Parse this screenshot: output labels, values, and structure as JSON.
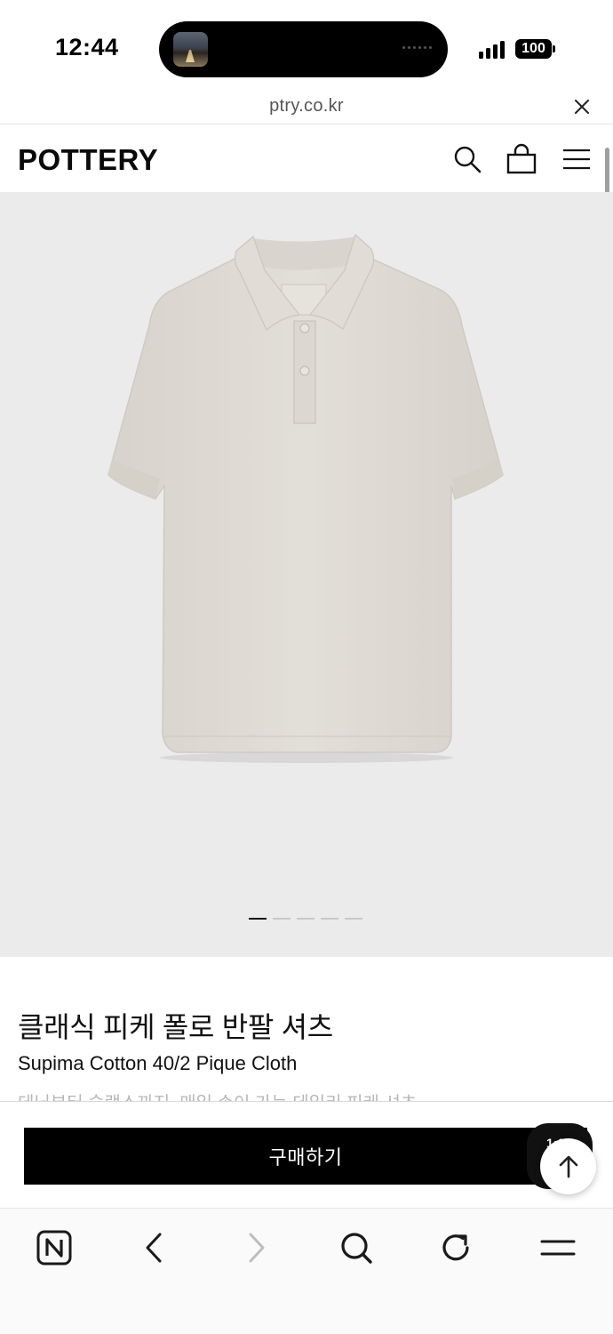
{
  "status_bar": {
    "time": "12:44",
    "battery": "100"
  },
  "browser": {
    "url": "ptry.co.kr",
    "close_icon": "close-icon"
  },
  "header": {
    "logo": "POTTERY",
    "icons": [
      "search-icon",
      "shopping-bag-icon",
      "menu-icon"
    ]
  },
  "product": {
    "image_pagination": {
      "total": 5,
      "current": 1
    },
    "name": "클래식 피케 폴로 반팔 셔츠",
    "subtitle": "Supima Cotton 40/2 Pique Cloth",
    "description": "데님부터 슬랙스까지, 매일 손이 가는 데일리 피케 셔츠"
  },
  "purchase": {
    "buy_label": "구매하기",
    "badge_text": "1:1"
  },
  "toolbar": {
    "icons": [
      "naver-home-icon",
      "back-icon",
      "forward-icon",
      "search-icon",
      "reload-icon",
      "menu-icon"
    ]
  },
  "colors": {
    "accent": "#000000",
    "hero_background": "#ebebeb",
    "shirt": "#dedad4"
  }
}
